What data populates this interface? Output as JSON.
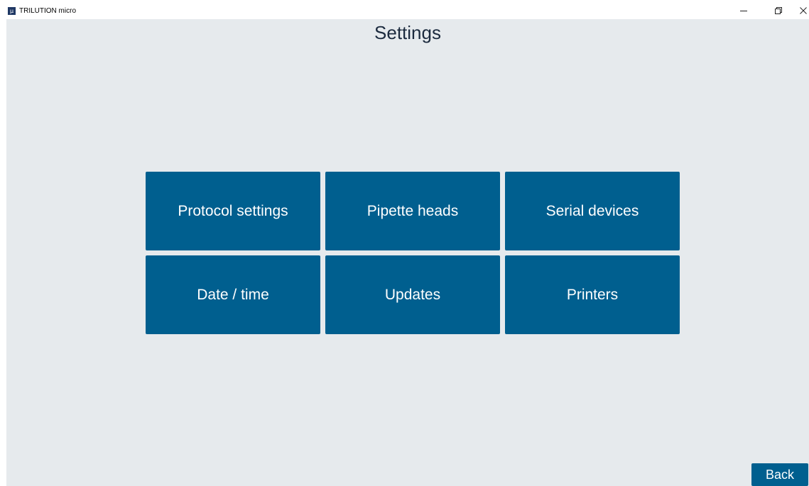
{
  "window": {
    "app_icon_glyph": "µ",
    "title": "TRILUTION micro",
    "controls": {
      "minimize_icon": "minimize-icon",
      "restore_icon": "restore-icon",
      "close_icon": "close-icon"
    }
  },
  "page": {
    "title": "Settings"
  },
  "tiles": [
    {
      "label": "Protocol settings"
    },
    {
      "label": "Pipette heads"
    },
    {
      "label": "Serial devices"
    },
    {
      "label": "Date / time"
    },
    {
      "label": "Updates"
    },
    {
      "label": "Printers"
    }
  ],
  "footer": {
    "back_label": "Back"
  },
  "colors": {
    "accent": "#005f8f",
    "background": "#e6eaed",
    "title_text": "#1c2b3f"
  }
}
